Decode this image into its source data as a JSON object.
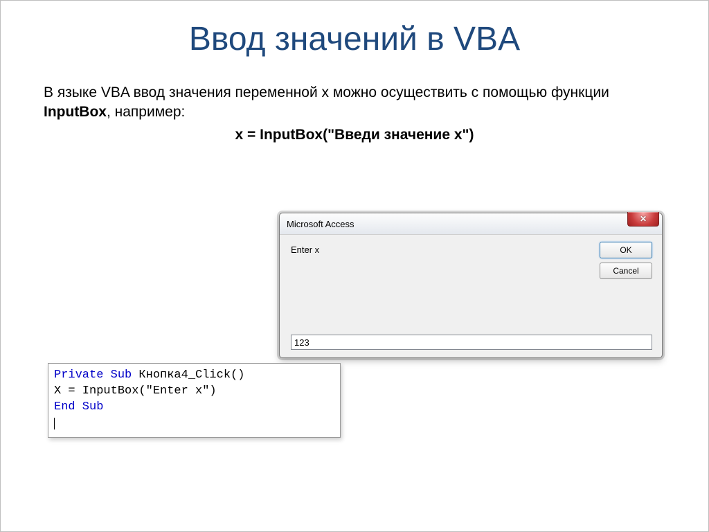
{
  "title": "Ввод значений в VBA",
  "body": {
    "l1a": "В языке VBA ввод значения переменной x можно осуществить с помощью функции ",
    "l1b": "InputBox",
    "l1c": ", например:",
    "code": "x = InputBox(\"Введи значение x\")"
  },
  "dialog": {
    "title": "Microsoft Access",
    "prompt": "Enter x",
    "input_value": "123",
    "ok": "OK",
    "cancel": "Cancel"
  },
  "code": {
    "l1_kw1": "Private Sub",
    "l1_txt": " Кнопка4_Click()",
    "l2": "X = InputBox(\"Enter x\")",
    "l3": "End Sub"
  }
}
